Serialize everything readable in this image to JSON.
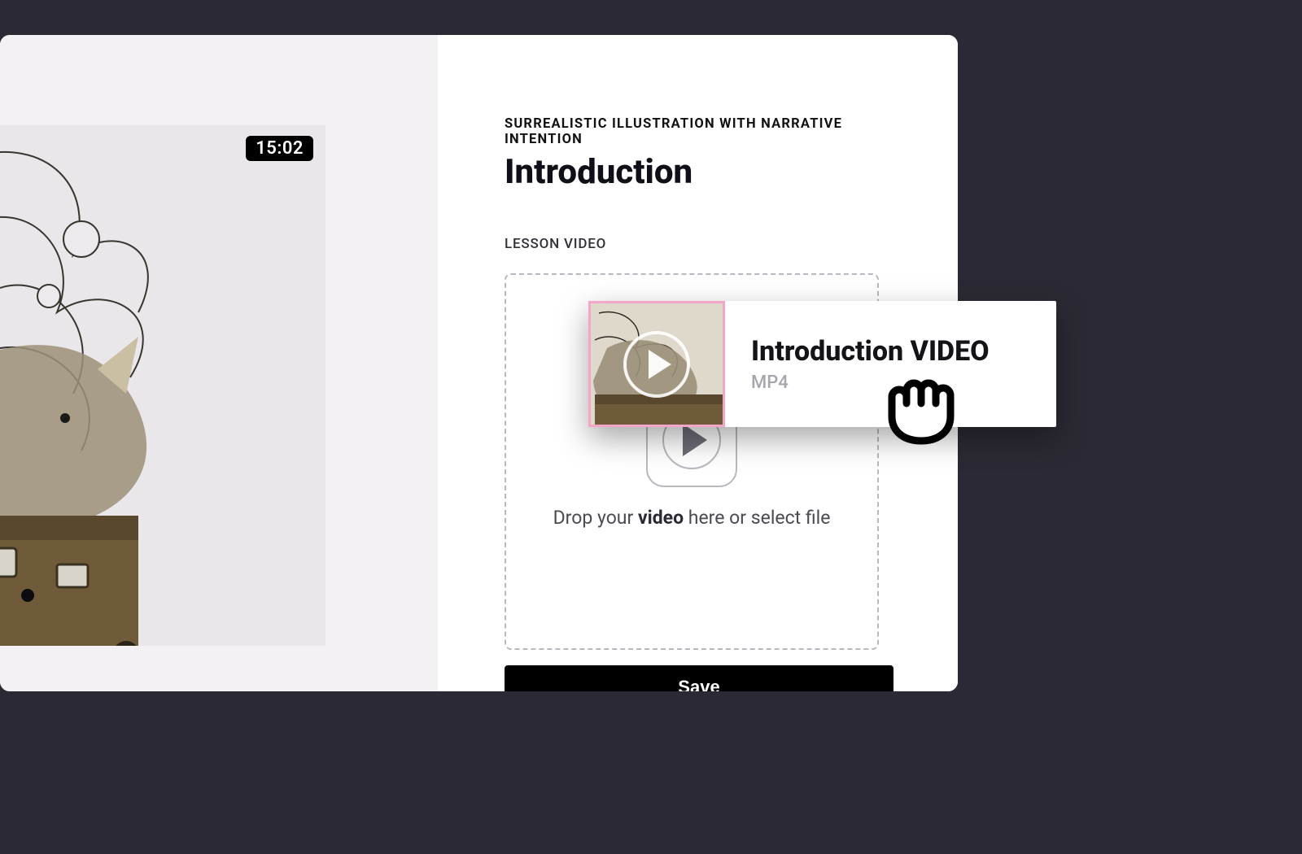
{
  "course": {
    "name": "SURREALISTIC ILLUSTRATION WITH NARRATIVE INTENTION",
    "lesson_title": "Introduction"
  },
  "preview": {
    "duration": "15:02"
  },
  "editor": {
    "section_label": "LESSON VIDEO",
    "dropzone": {
      "prefix": "Drop your ",
      "bold": "video",
      "suffix": " here or select file"
    },
    "save_label": "Save"
  },
  "drag_item": {
    "title": "Introduction VIDEO",
    "format": "MP4"
  },
  "colors": {
    "page_bg": "#2b2a34",
    "accent_pink": "#f4a6c8"
  }
}
